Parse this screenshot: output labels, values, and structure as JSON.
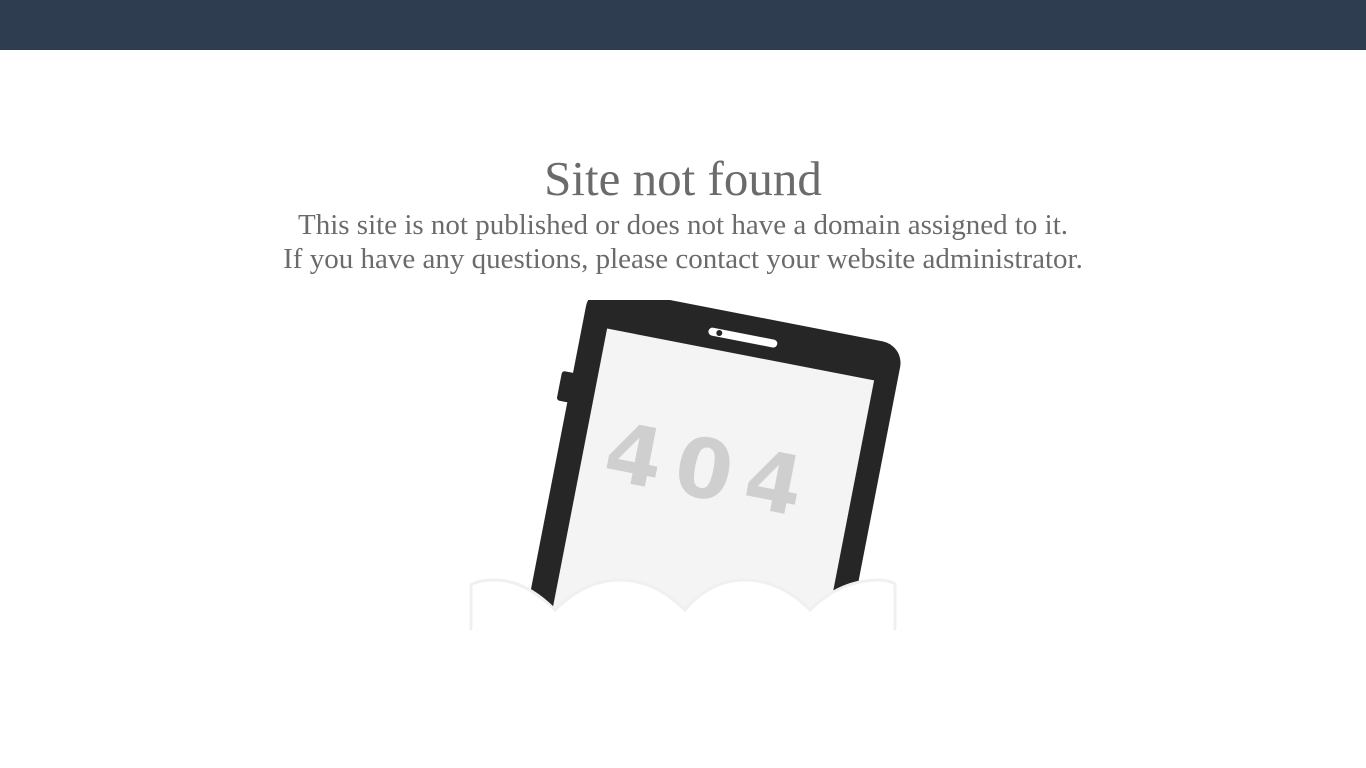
{
  "header": {
    "background_color": "#2e3e50"
  },
  "main": {
    "title": "Site not found",
    "line1": "This site is not published or does not have a domain assigned to it.",
    "line2": "If you have any questions, please contact your website administrator."
  },
  "illustration": {
    "screen_text": "404",
    "icon": "tablet-404-icon"
  }
}
